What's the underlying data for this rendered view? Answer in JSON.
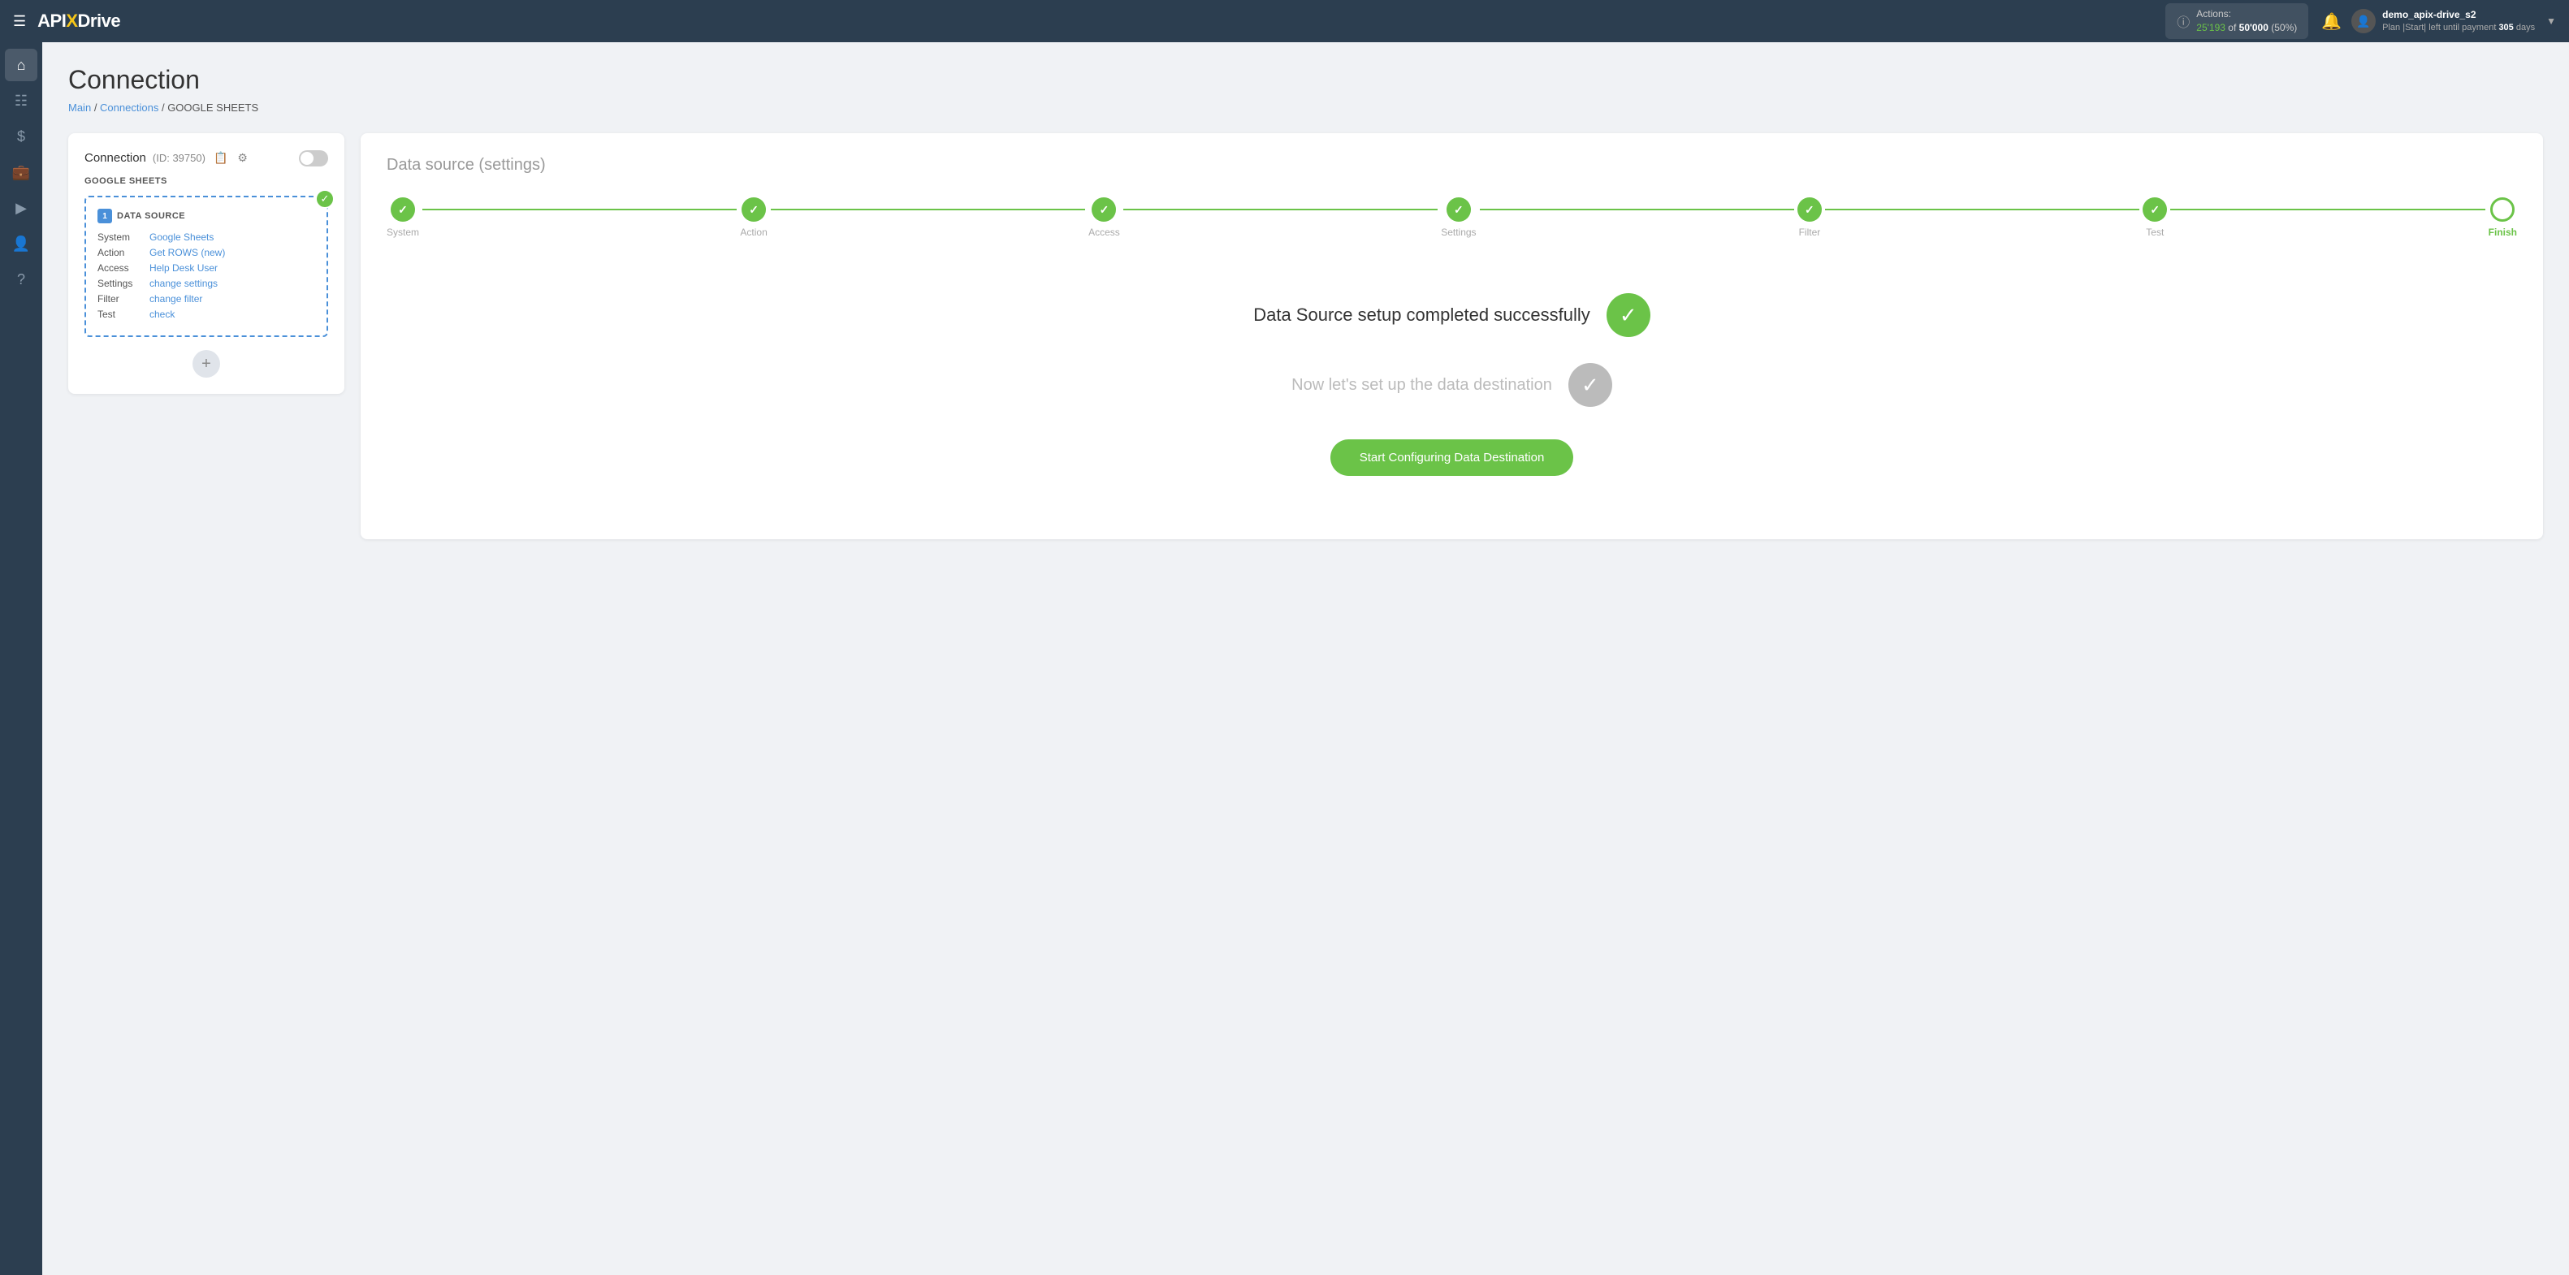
{
  "topnav": {
    "logo": {
      "api": "API",
      "x": "X",
      "drive": "Drive"
    },
    "actions": {
      "label": "Actions:",
      "current": "25'193",
      "of": "of",
      "total": "50'000",
      "percent": "(50%)"
    },
    "user": {
      "name": "demo_apix-drive_s2",
      "plan": "Plan |Start| left until payment",
      "days": "305",
      "days_label": "days"
    }
  },
  "breadcrumb": {
    "main": "Main",
    "connections": "Connections",
    "current": "GOOGLE SHEETS"
  },
  "page": {
    "title": "Connection"
  },
  "left_card": {
    "connection_label": "Connection",
    "connection_id": "(ID: 39750)",
    "google_sheets": "GOOGLE SHEETS",
    "data_source_num": "1",
    "data_source_label": "DATA SOURCE",
    "fields": [
      {
        "key": "System",
        "value": "Google Sheets"
      },
      {
        "key": "Action",
        "value": "Get ROWS (new)"
      },
      {
        "key": "Access",
        "value": "Help Desk User"
      },
      {
        "key": "Settings",
        "value": "change settings"
      },
      {
        "key": "Filter",
        "value": "change filter"
      },
      {
        "key": "Test",
        "value": "check"
      }
    ],
    "add_btn": "+"
  },
  "right_card": {
    "title": "Data source",
    "title_sub": "(settings)",
    "steps": [
      {
        "label": "System",
        "state": "done"
      },
      {
        "label": "Action",
        "state": "done"
      },
      {
        "label": "Access",
        "state": "done"
      },
      {
        "label": "Settings",
        "state": "done"
      },
      {
        "label": "Filter",
        "state": "done"
      },
      {
        "label": "Test",
        "state": "done"
      },
      {
        "label": "Finish",
        "state": "active"
      }
    ],
    "success_title": "Data Source setup completed successfully",
    "next_title": "Now let's set up the data destination",
    "cta_button": "Start Configuring Data Destination"
  }
}
